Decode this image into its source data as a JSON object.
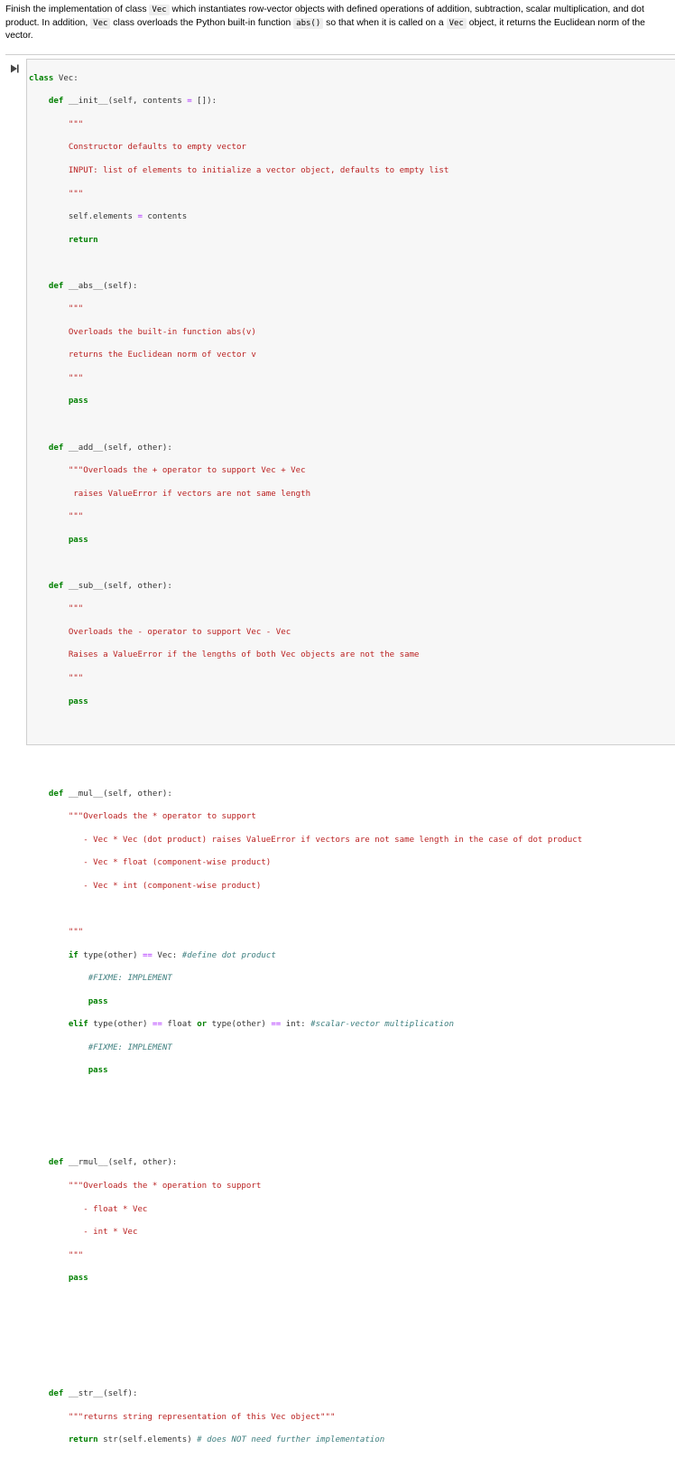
{
  "prompt": {
    "t1": "Finish the implementation of class ",
    "c1": "Vec",
    "t2": " which instantiates row-vector objects with defined operations of addition, subtraction, scalar multiplication, and dot product. In addition, ",
    "c2": "Vec",
    "t3": " class overloads the Python built-in function ",
    "c3": "abs()",
    "t4": " so that when it is called on a ",
    "c4": "Vec",
    "t5": " object, it returns the Euclidean norm of the vector."
  },
  "icons": {
    "run": "run-cell-icon"
  },
  "colors": {
    "keyword": "#008000",
    "string": "#ba2121",
    "comment": "#408080",
    "operator": "#aa22ff",
    "cell_background": "#f7f7f7"
  },
  "code": {
    "kw_class": "class",
    "kw_def": "def",
    "kw_return": "return",
    "kw_pass": "pass",
    "kw_if": "if",
    "kw_elif": "elif",
    "kw_or": "or",
    "l1_name": " Vec:",
    "l2_sig": " __init__(self, contents ",
    "op_eq": "=",
    "l2_rest": " []):",
    "doc_q": "\"\"\"",
    "l4": "Constructor defaults to empty vector",
    "l5": "INPUT: list of elements to initialize a vector object, defaults to empty list",
    "l7_lhs": "self.elements ",
    "l7_rhs": " contents",
    "abs_sig": " __abs__(self):",
    "abs_d1": "Overloads the built-in function abs(v)",
    "abs_d2": "returns the Euclidean norm of vector v",
    "add_sig": " __add__(self, other):",
    "add_d1": "\"\"\"Overloads the + operator to support Vec + Vec",
    "add_d2": " raises ValueError if vectors are not same length",
    "sub_sig": " __sub__(self, other):",
    "sub_d1": "Overloads the - operator to support Vec - Vec",
    "sub_d2": "Raises a ValueError if the lengths of both Vec objects are not the same",
    "mul_sig": " __mul__(self, other):",
    "mul_d1": "\"\"\"Overloads the * operator to support",
    "mul_d2": "   - Vec * Vec (dot product) raises ValueError if vectors are not same length in the case of dot product",
    "mul_d3": "   - Vec * float (component-wise product)",
    "mul_d4": "   - Vec * int (component-wise product)",
    "if1_a": " type(other) ",
    "op_eqeq": "==",
    "if1_b": " Vec: ",
    "if1_cm": "#define dot product",
    "fixme": "#FIXME: IMPLEMENT",
    "elif_a": " type(other) ",
    "elif_b": " float ",
    "elif_c": " type(other) ",
    "elif_d": " int: ",
    "elif_cm": "#scalar-vector multiplication",
    "rmul_sig": " __rmul__(self, other):",
    "rmul_d1": "\"\"\"Overloads the * operation to support",
    "rmul_d2": "   - float * Vec",
    "rmul_d3": "   - int * Vec",
    "str_sig": " __str__(self):",
    "str_doc": "\"\"\"returns string representation of this Vec object\"\"\"",
    "str_ret": " str(self.elements) ",
    "str_cm": "# does NOT need further implementation"
  }
}
